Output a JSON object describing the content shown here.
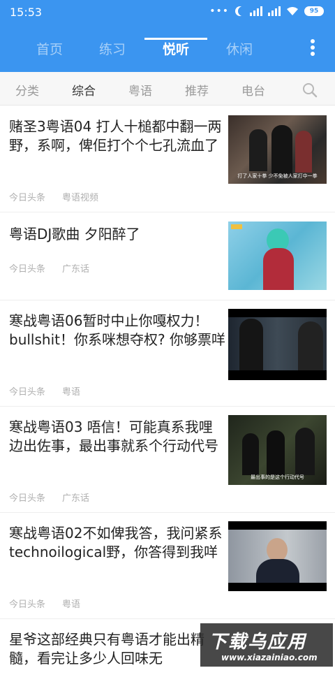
{
  "status_bar": {
    "time": "15:53",
    "dots": "•••",
    "battery": "95"
  },
  "main_tabs": [
    {
      "label": "首页"
    },
    {
      "label": "练习"
    },
    {
      "label": "悦听"
    },
    {
      "label": "休闲"
    }
  ],
  "sub_tabs": [
    {
      "label": "分类"
    },
    {
      "label": "综合"
    },
    {
      "label": "粤语"
    },
    {
      "label": "推荐"
    },
    {
      "label": "电台"
    }
  ],
  "feed": [
    {
      "title": "赌圣3粤语04 打人十槌都中翻一两野，系啊，俾佢打个个七孔流血了",
      "source": "今日头条",
      "tag": "粤语视频",
      "thumb_caption": "打了人家十拳 少不免被人家打中一拳"
    },
    {
      "title": "粤语DJ歌曲  夕阳醉了",
      "source": "今日头条",
      "tag": "广东话",
      "thumb_caption": ""
    },
    {
      "title": "寒战粤语06暂时中止你嘎权力！bullshit！你系咪想夺权? 你够票咩",
      "source": "今日头条",
      "tag": "粤语",
      "thumb_caption": ""
    },
    {
      "title": "寒战粤语03 唔信！可能真系我哩边出佐事，最出事就系个行动代号",
      "source": "今日头条",
      "tag": "广东话",
      "thumb_caption": "最出事的是这个行动代号"
    },
    {
      "title": "寒战粤语02不如俾我答，我问紧系technoilogical野，你答得到我咩",
      "source": "今日头条",
      "tag": "粤语",
      "thumb_caption": ""
    },
    {
      "title": "星爷这部经典只有粤语才能出精髓，看完让多少人回味无",
      "source": "",
      "tag": "",
      "thumb_caption": ""
    }
  ],
  "watermark": {
    "title": "下载乌应用",
    "url": "www.xiazainiao.com"
  },
  "colors": {
    "accent": "#3b95f0",
    "text": "#222222",
    "muted": "#b0b0b0"
  }
}
